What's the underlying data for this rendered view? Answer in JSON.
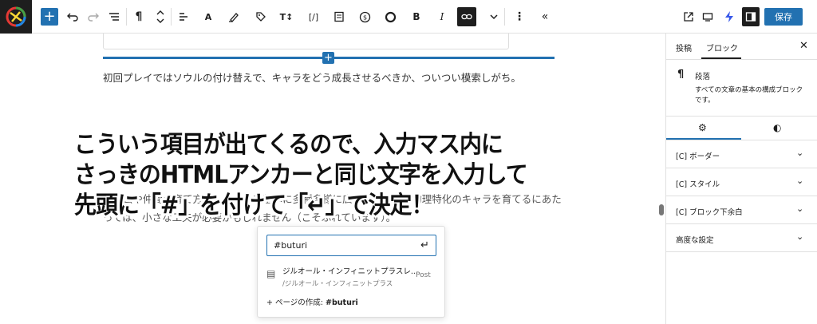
{
  "toolbar": {
    "heading_label": "A",
    "text_transform": "T↕",
    "code_label": "[/]",
    "bold_label": "B",
    "italic_label": "I",
    "save_label": "保存"
  },
  "editor": {
    "paragraph_1": "初回プレイではソウルの付け替えで、キャラをどう成長させるべきか、ついつい模索しがち。",
    "paragraph_2_line1": "主人公や仲間の育て方は、ソウルを基本に多種多様に広がりますが、物理特化のキャラを育てるにあた",
    "paragraph_2_line2": "っては、小さな工夫が必要かもしれません（こそふれています）。",
    "annotation_line1": "こういう項目が出てくるので、入力マス内に",
    "annotation_line2": "さっきのHTMLアンカーと同じ文字を入力して",
    "annotation_line3": "先頭に「#」を付けて「↵」で決定！"
  },
  "link_popover": {
    "input_value": "#buturi",
    "suggestion_title": "ジルオール・インフィニットプラスレ...",
    "suggestion_url": "/ジルオール・インフィニットプラス",
    "suggestion_type": "Post",
    "create_prefix": "ページの作成: ",
    "create_value": "#buturi"
  },
  "sidebar": {
    "tab_post": "投稿",
    "tab_block": "ブロック",
    "block_name": "段落",
    "block_description": "すべての文章の基本の構成ブロックです。",
    "panels": [
      {
        "label": "[C] ボーダー"
      },
      {
        "label": "[C] スタイル"
      },
      {
        "label": "[C] ブロック下余白"
      },
      {
        "label": "高度な設定"
      }
    ]
  },
  "colors": {
    "accent": "#2271b1",
    "dark": "#1e1e1e"
  }
}
